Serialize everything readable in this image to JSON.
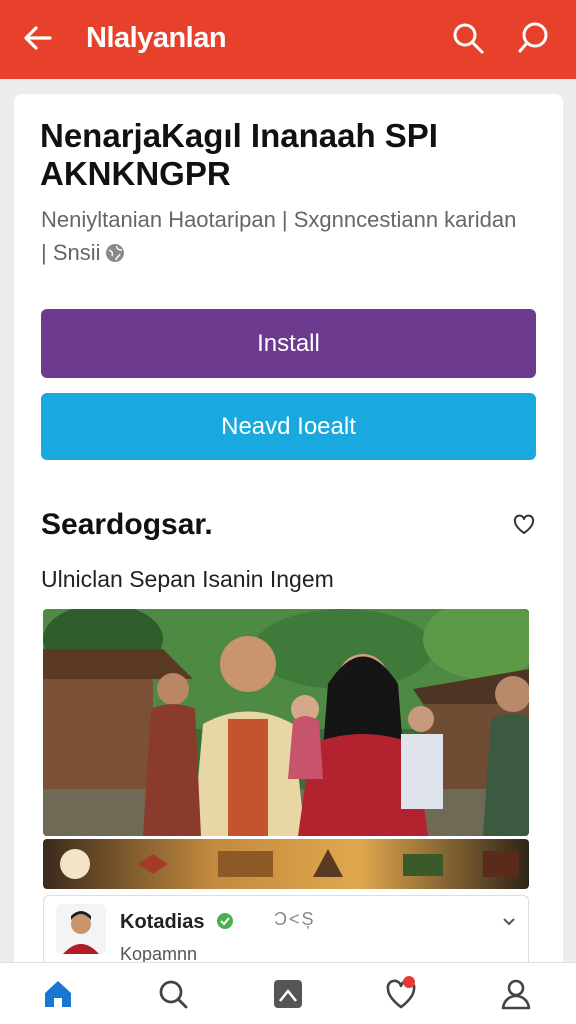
{
  "header": {
    "title": "Nlalyanlan",
    "accent_color": "#e8412b",
    "left_icon": "back-arrow-icon",
    "right_icons": [
      "search-icon",
      "search-icon"
    ]
  },
  "app": {
    "name": "NenarjaKagıl Inanaah SPI AKNKNGPR",
    "developer_line": "Neniyltanian Haotaripan | Sxgnncestiann karidan | Snsii"
  },
  "buttons": {
    "install_label": "Install",
    "install_color": "#6c3a8e",
    "secondary_label": "Neavd Ioealt",
    "secondary_color": "#1aa9de"
  },
  "section": {
    "title": "Seardogsar.",
    "subtitle": "Ulniclan Sepan Isanin Ingem"
  },
  "review": {
    "name": "Kotadias",
    "subtitle": "Kopamnn",
    "meta": "Ɔ<Ș"
  },
  "bottom_nav": {
    "items": [
      {
        "icon": "home-icon",
        "active": true
      },
      {
        "icon": "search-icon",
        "active": false
      },
      {
        "icon": "apps-icon",
        "active": false
      },
      {
        "icon": "heart-icon",
        "active": false,
        "notification": true
      },
      {
        "icon": "person-icon",
        "active": false
      }
    ],
    "active_color": "#1976d2"
  }
}
